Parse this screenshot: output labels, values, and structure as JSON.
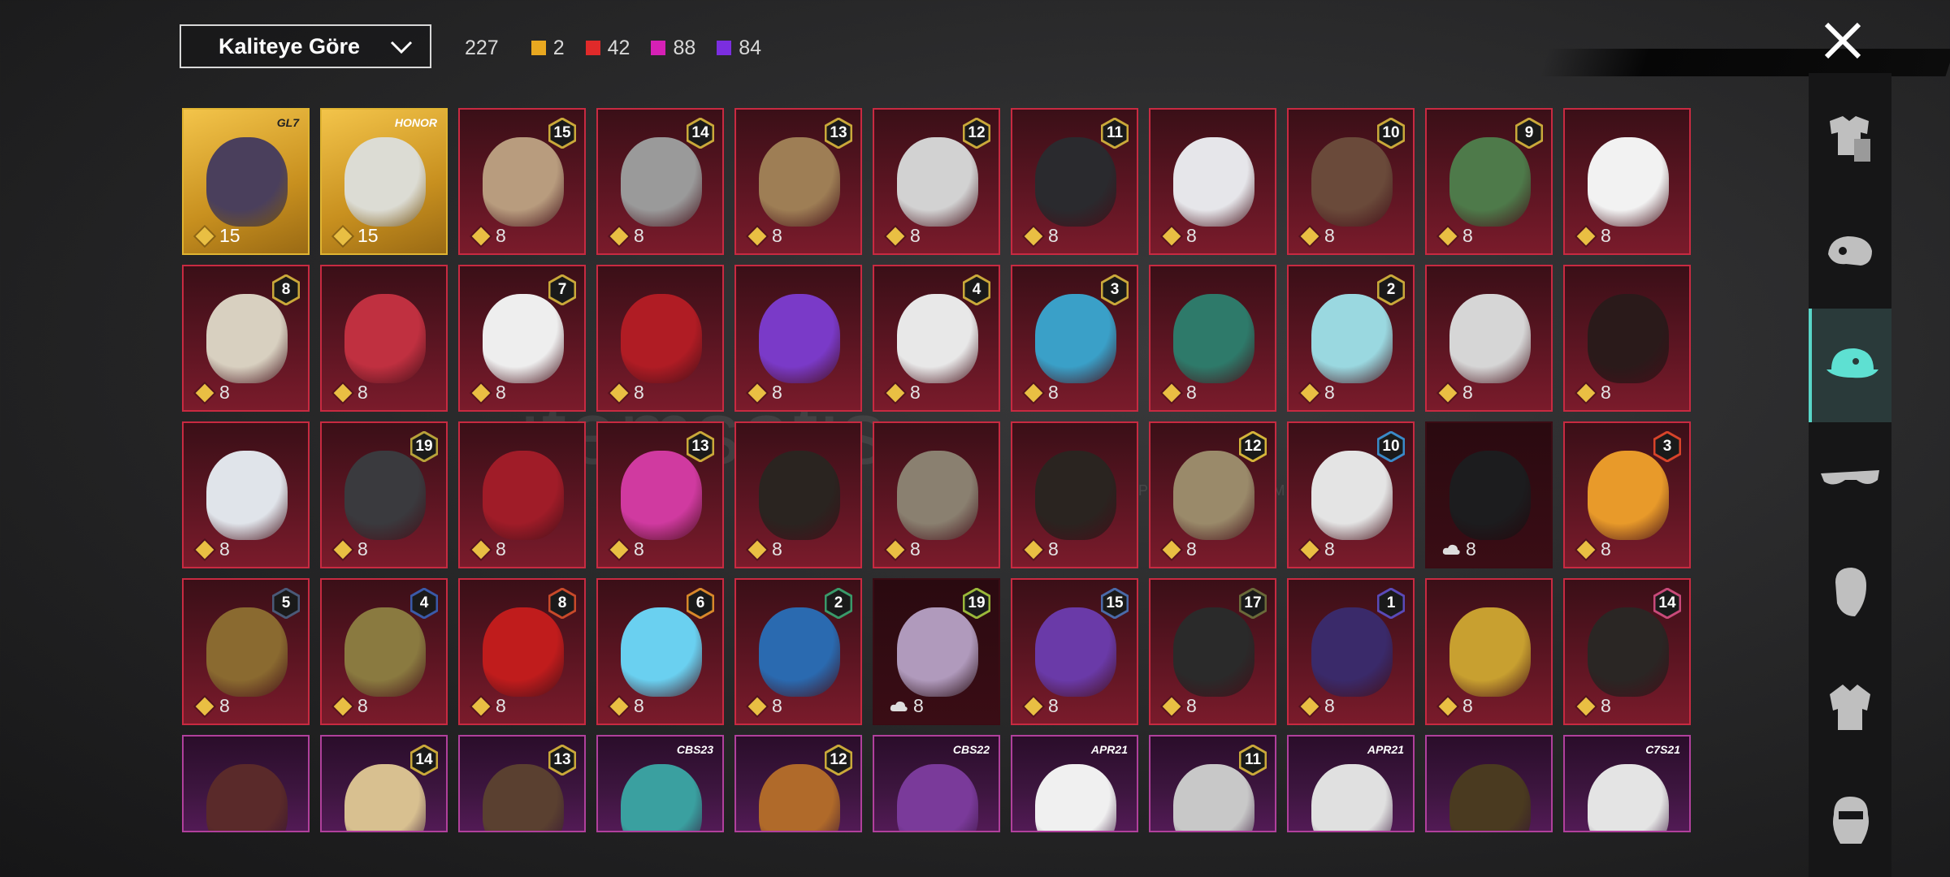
{
  "toolbar": {
    "sort_label": "Kaliteye Göre",
    "total_count": "227",
    "counts": [
      {
        "value": "2",
        "color": "#e8a820"
      },
      {
        "value": "42",
        "color": "#e02a2a"
      },
      {
        "value": "88",
        "color": "#d620b5"
      },
      {
        "value": "84",
        "color": "#7b2ee0"
      }
    ]
  },
  "watermark": {
    "brand": "itemsatis",
    "sub": "HESAP / SATIŞ / ITEM / E-PIN     .COM"
  },
  "sidebar": {
    "items": [
      {
        "name": "outfit-icon",
        "active": false
      },
      {
        "name": "mask-icon",
        "active": false
      },
      {
        "name": "cap-icon",
        "active": true
      },
      {
        "name": "glasses-icon",
        "active": false
      },
      {
        "name": "face-icon",
        "active": false
      },
      {
        "name": "jacket-icon",
        "active": false
      },
      {
        "name": "emote-icon",
        "active": false
      }
    ]
  },
  "rows": [
    [
      {
        "style": "gold",
        "event": "GL7",
        "eventDark": true,
        "amount": "15",
        "art": "#4a3f5c"
      },
      {
        "style": "gold",
        "event": "HONOR",
        "eventDark": false,
        "amount": "15",
        "art": "#dcdcd4"
      },
      {
        "style": "red",
        "badge": "15",
        "badgeColor": "#caa93a",
        "amount": "8",
        "art": "#b89c7e"
      },
      {
        "style": "red",
        "badge": "14",
        "badgeColor": "#caa93a",
        "amount": "8",
        "art": "#9a9a9a"
      },
      {
        "style": "red",
        "badge": "13",
        "badgeColor": "#caa93a",
        "amount": "8",
        "art": "#9e7e55"
      },
      {
        "style": "red",
        "badge": "12",
        "badgeColor": "#caa93a",
        "amount": "8",
        "art": "#d2d2d2"
      },
      {
        "style": "red",
        "badge": "11",
        "badgeColor": "#caa93a",
        "amount": "8",
        "art": "#2a2a2e"
      },
      {
        "style": "red",
        "amount": "8",
        "art": "#e6e6ea"
      },
      {
        "style": "red",
        "badge": "10",
        "badgeColor": "#caa93a",
        "amount": "8",
        "art": "#6a4a3a"
      },
      {
        "style": "red",
        "badge": "9",
        "badgeColor": "#caa93a",
        "amount": "8",
        "art": "#4e7a4a"
      },
      {
        "style": "red",
        "amount": "8",
        "art": "#f2f2f2"
      }
    ],
    [
      {
        "style": "red",
        "badge": "8",
        "badgeColor": "#caa93a",
        "amount": "8",
        "art": "#d8d0c0"
      },
      {
        "style": "red",
        "amount": "8",
        "art": "#c03040"
      },
      {
        "style": "red",
        "badge": "7",
        "badgeColor": "#caa93a",
        "amount": "8",
        "art": "#eeeeee"
      },
      {
        "style": "red",
        "amount": "8",
        "art": "#b01c24"
      },
      {
        "style": "red",
        "amount": "8",
        "art": "#7a3ac8"
      },
      {
        "style": "red",
        "badge": "4",
        "badgeColor": "#caa93a",
        "amount": "8",
        "art": "#e8e8e8"
      },
      {
        "style": "red",
        "badge": "3",
        "badgeColor": "#caa93a",
        "amount": "8",
        "art": "#3aa0c8"
      },
      {
        "style": "red",
        "amount": "8",
        "art": "#2e7a6a"
      },
      {
        "style": "red",
        "badge": "2",
        "badgeColor": "#caa93a",
        "amount": "8",
        "art": "#9ad8e0"
      },
      {
        "style": "red",
        "amount": "8",
        "art": "#d6d6d6"
      },
      {
        "style": "red",
        "amount": "8",
        "art": "#2a1a1a"
      }
    ],
    [
      {
        "style": "red",
        "amount": "8",
        "art": "#e0e4ea"
      },
      {
        "style": "red",
        "badge": "19",
        "badgeColor": "#b8a23a",
        "amount": "8",
        "art": "#3a3a3e"
      },
      {
        "style": "red",
        "amount": "8",
        "art": "#a01c28"
      },
      {
        "style": "red",
        "badge": "13",
        "badgeColor": "#caa93a",
        "amount": "8",
        "art": "#d03aa0"
      },
      {
        "style": "red",
        "amount": "8",
        "art": "#2a2420"
      },
      {
        "style": "red",
        "amount": "8",
        "art": "#8a8070"
      },
      {
        "style": "red",
        "amount": "8",
        "art": "#2a2420"
      },
      {
        "style": "red",
        "badge": "12",
        "badgeColor": "#d4b43a",
        "amount": "8",
        "art": "#9a8a6a"
      },
      {
        "style": "red",
        "badge": "10",
        "badgeColor": "#3a8ac8",
        "amount": "8",
        "art": "#e4e4e4"
      },
      {
        "style": "dark",
        "cloud": true,
        "amount": "8",
        "art": "#1c1c1e"
      },
      {
        "style": "red",
        "badge": "3",
        "badgeColor": "#d8442a",
        "amount": "8",
        "art": "#e89a2a"
      }
    ],
    [
      {
        "style": "red",
        "badge": "5",
        "badgeColor": "#4a5a78",
        "amount": "8",
        "art": "#8a6a30"
      },
      {
        "style": "red",
        "badge": "4",
        "badgeColor": "#3a5aa8",
        "amount": "8",
        "art": "#8a7a40"
      },
      {
        "style": "red",
        "badge": "8",
        "badgeColor": "#c84a2a",
        "amount": "8",
        "art": "#c01c1c"
      },
      {
        "style": "red",
        "badge": "6",
        "badgeColor": "#d8882a",
        "amount": "8",
        "art": "#6ad0f0"
      },
      {
        "style": "red",
        "badge": "2",
        "badgeColor": "#3a9a6a",
        "amount": "8",
        "art": "#2a6ab0"
      },
      {
        "style": "dark",
        "cloud": true,
        "badge": "19",
        "badgeColor": "#9ab83a",
        "amount": "8",
        "art": "#b09abc"
      },
      {
        "style": "red",
        "badge": "15",
        "badgeColor": "#4a6aa8",
        "amount": "8",
        "art": "#6a3aa8"
      },
      {
        "style": "red",
        "badge": "17",
        "badgeColor": "#6a6a3a",
        "amount": "8",
        "art": "#2a2a2a"
      },
      {
        "style": "red",
        "badge": "1",
        "badgeColor": "#5a4ab8",
        "amount": "8",
        "art": "#3a2a6a"
      },
      {
        "style": "red",
        "amount": "8",
        "art": "#c8a030"
      },
      {
        "style": "red",
        "badge": "14",
        "badgeColor": "#c84a7a",
        "amount": "8",
        "art": "#2a2624"
      }
    ],
    [
      {
        "style": "purple",
        "art": "#5a2a2a"
      },
      {
        "style": "purple",
        "badge": "14",
        "badgeColor": "#caa93a",
        "art": "#d8c090"
      },
      {
        "style": "purple",
        "badge": "13",
        "badgeColor": "#caa93a",
        "art": "#5a4030"
      },
      {
        "style": "purple",
        "event": "CBS23",
        "eventDark": false,
        "art": "#3aa0a0"
      },
      {
        "style": "purple",
        "badge": "12",
        "badgeColor": "#caa93a",
        "art": "#b06a2a"
      },
      {
        "style": "purple",
        "event": "CBS22",
        "eventDark": false,
        "art": "#7a3a9a"
      },
      {
        "style": "purple",
        "event": "APR21",
        "eventDark": false,
        "art": "#f0f0f0"
      },
      {
        "style": "purple",
        "badge": "11",
        "badgeColor": "#caa93a",
        "art": "#c8c8c8"
      },
      {
        "style": "purple",
        "event": "APR21",
        "eventDark": false,
        "art": "#e0e0e0"
      },
      {
        "style": "purple",
        "art": "#4a3a20"
      },
      {
        "style": "purple",
        "event": "C7S21",
        "eventDark": false,
        "art": "#e4e4e4"
      }
    ]
  ]
}
